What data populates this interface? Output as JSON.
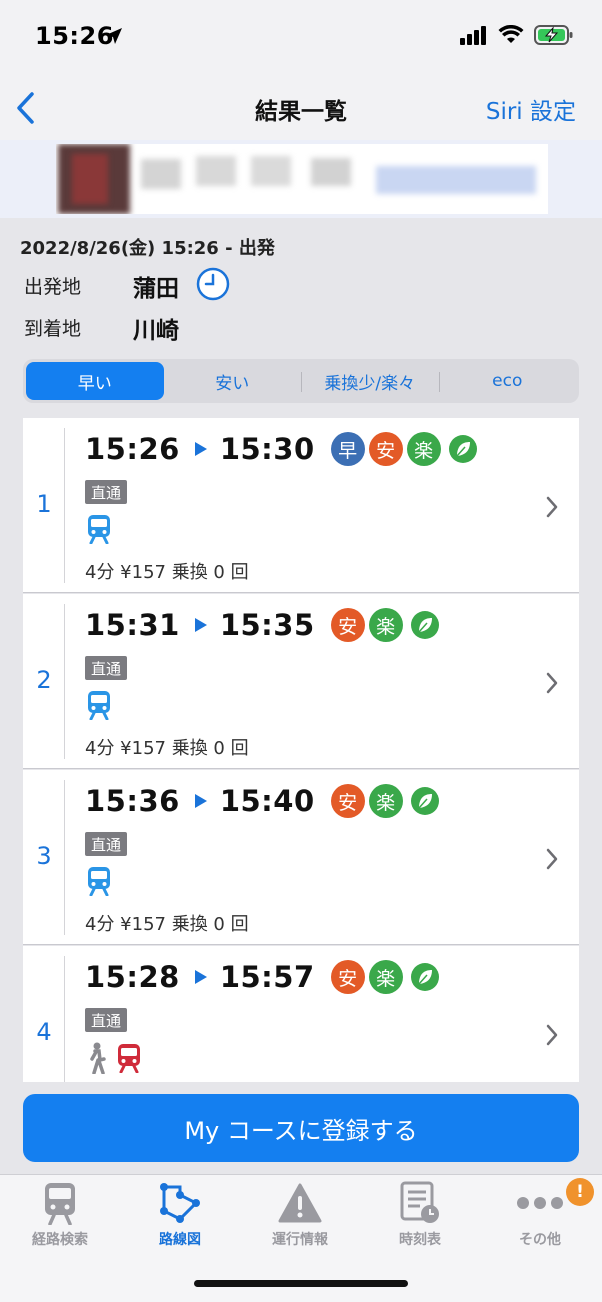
{
  "status_bar": {
    "time": "15:26"
  },
  "nav": {
    "title": "結果一覧",
    "siri": "Siri 設定"
  },
  "info": {
    "datetime": "2022/8/26(金) 15:26 - 出発",
    "from_label": "出発地",
    "from_value": "蒲田",
    "to_label": "到着地",
    "to_value": "川崎"
  },
  "segments": [
    {
      "label": "早い",
      "active": true
    },
    {
      "label": "安い",
      "active": false
    },
    {
      "label": "乗換少/楽々",
      "active": false
    },
    {
      "label": "eco",
      "active": false
    }
  ],
  "routes": [
    {
      "index": "1",
      "depart": "15:26",
      "arrive": "15:30",
      "badges": [
        "早",
        "安",
        "楽"
      ],
      "eco_leaf": true,
      "tag": "直通",
      "modes": [
        "train-blue-icon"
      ],
      "summary": "4分  ¥157  乗換 0 回"
    },
    {
      "index": "2",
      "depart": "15:31",
      "arrive": "15:35",
      "badges": [
        "安",
        "楽"
      ],
      "eco_leaf": true,
      "tag": "直通",
      "modes": [
        "train-blue-icon"
      ],
      "summary": "4分  ¥157  乗換 0 回"
    },
    {
      "index": "3",
      "depart": "15:36",
      "arrive": "15:40",
      "badges": [
        "安",
        "楽"
      ],
      "eco_leaf": true,
      "tag": "直通",
      "modes": [
        "train-blue-icon"
      ],
      "summary": "4分  ¥157  乗換 0 回"
    },
    {
      "index": "4",
      "depart": "15:28",
      "arrive": "15:57",
      "badges": [
        "安",
        "楽"
      ],
      "eco_leaf": true,
      "tag": "直通",
      "modes": [
        "walk-icon",
        "train-red-icon"
      ],
      "summary": ""
    }
  ],
  "register_button": "My コースに登録する",
  "tabs": [
    {
      "label": "経路検索",
      "icon": "train-icon",
      "active": false
    },
    {
      "label": "路線図",
      "icon": "route-map-icon",
      "active": true
    },
    {
      "label": "運行情報",
      "icon": "warning-icon",
      "active": false
    },
    {
      "label": "時刻表",
      "icon": "timetable-icon",
      "active": false
    },
    {
      "label": "その他",
      "icon": "more-icon",
      "active": false
    }
  ],
  "notification_badge": "!",
  "colors": {
    "accent": "#147ff0",
    "link": "#1a73d9",
    "haya": "#3c6fb4",
    "yasu": "#e35a27",
    "raku": "#3aa84a"
  }
}
